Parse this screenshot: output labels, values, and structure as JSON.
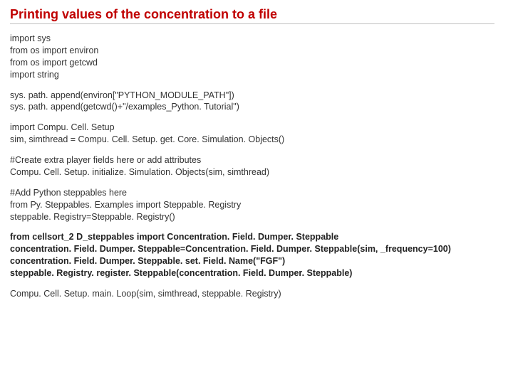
{
  "title": "Printing values of the concentration to a file",
  "blocks": [
    {
      "text": "import sys\nfrom os import environ\nfrom os import getcwd\nimport string",
      "bold": false
    },
    {
      "text": "sys. path. append(environ[\"PYTHON_MODULE_PATH\"])\nsys. path. append(getcwd()+\"/examples_Python. Tutorial\")",
      "bold": false
    },
    {
      "text": "import Compu. Cell. Setup\nsim, simthread = Compu. Cell. Setup. get. Core. Simulation. Objects()",
      "bold": false
    },
    {
      "text": "#Create extra player fields here or add attributes\nCompu. Cell. Setup. initialize. Simulation. Objects(sim, simthread)",
      "bold": false
    },
    {
      "text": "#Add Python steppables here\nfrom Py. Steppables. Examples import Steppable. Registry\nsteppable. Registry=Steppable. Registry()",
      "bold": false
    },
    {
      "text": "from cellsort_2 D_steppables import Concentration. Field. Dumper. Steppable\nconcentration. Field. Dumper. Steppable=Concentration. Field. Dumper. Steppable(sim, _frequency=100)\nconcentration. Field. Dumper. Steppable. set. Field. Name(\"FGF\")\nsteppable. Registry. register. Steppable(concentration. Field. Dumper. Steppable)",
      "bold": true
    },
    {
      "text": "Compu. Cell. Setup. main. Loop(sim, simthread, steppable. Registry)",
      "bold": false
    }
  ]
}
